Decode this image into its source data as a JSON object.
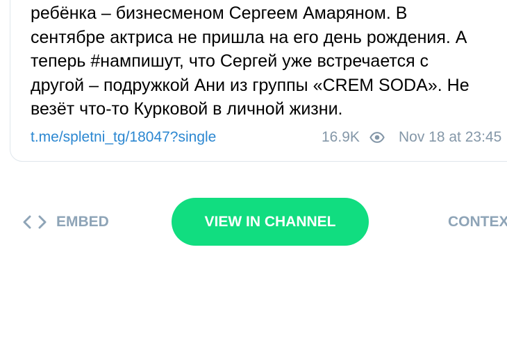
{
  "post": {
    "lines": [
      "ребёнка – бизнесменом Сергеем Амаряном. В",
      "сентябре актриса не пришла на его день рождения. А",
      "теперь #нампишут, что Сергей уже встречается с",
      "другой – подружкой Ани из группы «CREM SODA». Не",
      "везёт что-то Курковой в личной жизни."
    ],
    "link": "t.me/spletni_tg/18047?single",
    "views": "16.9K",
    "date": "Nov 18 at 23:45",
    "view_icon": "eye-icon"
  },
  "actions": {
    "embed_label": "EMBED",
    "embed_icon": "code-icon",
    "view_channel_label": "VIEW IN CHANNEL",
    "context_label": "CONTEXT"
  },
  "colors": {
    "link": "#2b87d1",
    "muted": "#8497a8",
    "action_muted": "#8ea4b7",
    "accent_green": "#11dd80",
    "card_border": "#dfe6ec"
  }
}
